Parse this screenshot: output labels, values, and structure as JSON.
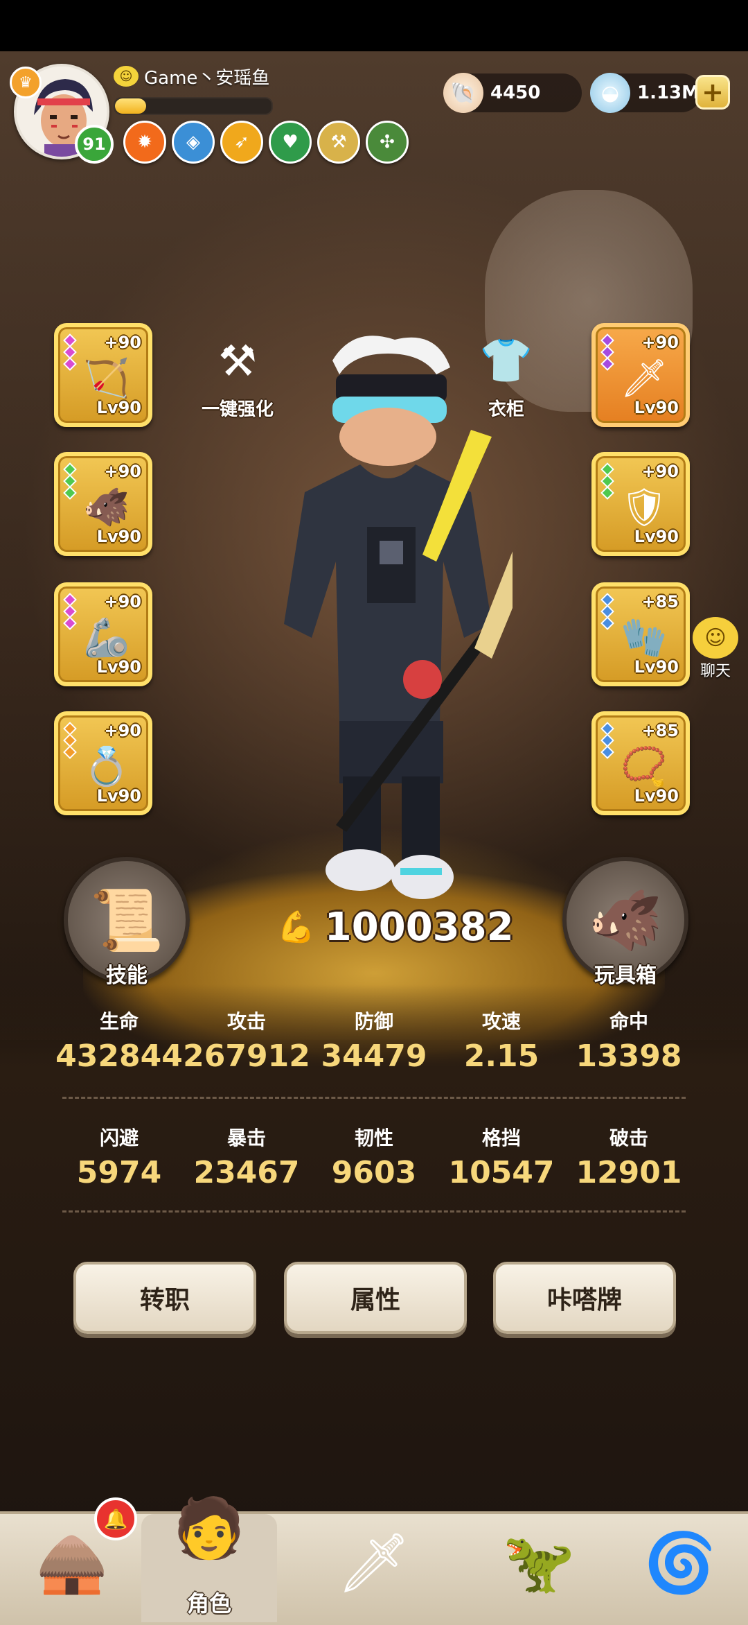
{
  "player": {
    "name": "Game丶安瑶鱼",
    "level": "91",
    "xp_fraction": 0.2,
    "name_emoji": "smiley-icon"
  },
  "medals": [
    {
      "icon": "flame-medal-icon",
      "color": "#f26a1b",
      "glyph": "✹"
    },
    {
      "icon": "water-medal-icon",
      "color": "#3b8fd6",
      "glyph": "◈"
    },
    {
      "icon": "sprint-medal-icon",
      "color": "#f0a81c",
      "glyph": "➶"
    },
    {
      "icon": "heart-medal-icon",
      "color": "#2f9b4a",
      "glyph": "♥"
    },
    {
      "icon": "axe-medal-icon",
      "color": "#d8b24a",
      "glyph": "⚒"
    },
    {
      "icon": "cactus-medal-icon",
      "color": "#4a8a3a",
      "glyph": "✣"
    }
  ],
  "currency": {
    "shells": "4450",
    "pearls": "1.13M"
  },
  "equipment_left": [
    {
      "plus": "+90",
      "level": "Lv90",
      "icon": "bow-icon",
      "glyph": "🏹",
      "gems": [
        "#d94bd1",
        "#d94bd1",
        "#d94bd1"
      ]
    },
    {
      "plus": "+90",
      "level": "Lv90",
      "icon": "boar-helmet-icon",
      "glyph": "🐗",
      "gems": [
        "#4fc94f",
        "#4fc94f",
        "#4fc94f"
      ]
    },
    {
      "plus": "+90",
      "level": "Lv90",
      "icon": "bracer-icon",
      "glyph": "🦾",
      "gems": [
        "#d94bd1",
        "#d94bd1",
        "#d94bd1"
      ]
    },
    {
      "plus": "+90",
      "level": "Lv90",
      "icon": "ring-icon",
      "glyph": "💍",
      "gems": [
        "#f39c2a",
        "#f39c2a",
        "#f39c2a"
      ]
    }
  ],
  "equipment_right": [
    {
      "plus": "+90",
      "level": "Lv90",
      "icon": "claw-weapon-icon",
      "glyph": "🗡",
      "gems": [
        "#a64be0",
        "#a64be0",
        "#a64be0"
      ]
    },
    {
      "plus": "+90",
      "level": "Lv90",
      "icon": "armor-icon",
      "glyph": "🛡",
      "gems": [
        "#4fc94f",
        "#4fc94f",
        "#4fc94f"
      ]
    },
    {
      "plus": "+85",
      "level": "Lv90",
      "icon": "glove-icon",
      "glyph": "🧤",
      "gems": [
        "#4a8ee0",
        "#4a8ee0",
        "#4a8ee0"
      ]
    },
    {
      "plus": "+85",
      "level": "Lv90",
      "icon": "necklace-icon",
      "glyph": "📿",
      "gems": [
        "#4a8ee0",
        "#4a8ee0",
        "#4a8ee0"
      ]
    }
  ],
  "quick_enhance": {
    "label": "一键强化"
  },
  "wardrobe": {
    "label": "衣柜"
  },
  "chat": {
    "label": "聊天"
  },
  "skills": {
    "label": "技能"
  },
  "toybox": {
    "label": "玩具箱"
  },
  "combat_power": "1000382",
  "stats_row1": [
    {
      "label": "生命",
      "value": "432844"
    },
    {
      "label": "攻击",
      "value": "267912"
    },
    {
      "label": "防御",
      "value": "34479"
    },
    {
      "label": "攻速",
      "value": "2.15"
    },
    {
      "label": "命中",
      "value": "13398"
    }
  ],
  "stats_row2": [
    {
      "label": "闪避",
      "value": "5974"
    },
    {
      "label": "暴击",
      "value": "23467"
    },
    {
      "label": "韧性",
      "value": "9603"
    },
    {
      "label": "格挡",
      "value": "10547"
    },
    {
      "label": "破击",
      "value": "12901"
    }
  ],
  "actions": {
    "job_change": "转职",
    "attributes": "属性",
    "cards": "咔嗒牌"
  },
  "nav": {
    "character_label": "角色"
  }
}
